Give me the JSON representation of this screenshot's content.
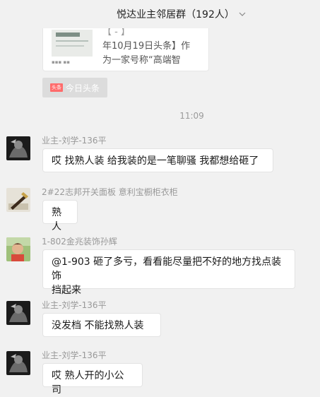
{
  "header": {
    "title": "悦达业主邻居群（192人）"
  },
  "shared_article": {
    "line1": "【 - 】",
    "line2": "年10月19日头条】作",
    "line3": "为一家号称“高端智",
    "thumb_caption": "▪▪▪ ▪▪",
    "source_logo_text": "头条",
    "source_label": "今日头条"
  },
  "timestamp": "11:09",
  "messages": [
    {
      "sender": "业主-刘学-136平",
      "text": "哎  找熟人装  给我装的是一笔聊骚  我都想给砸了"
    },
    {
      "sender": "2#22志邦开关面板 意利宝橱柜衣柜",
      "text": "熟人"
    },
    {
      "sender": "1-802金兆装饰孙辉",
      "text_line1": "@1-903 砸了多亏，看看能尽量把不好的地方找点装饰",
      "text_line2": "挡起来"
    },
    {
      "sender": "业主-刘学-136平",
      "text": "没发档  不能找熟人装"
    },
    {
      "sender": "业主-刘学-136平",
      "text": "哎  熟人开的小公司"
    }
  ]
}
